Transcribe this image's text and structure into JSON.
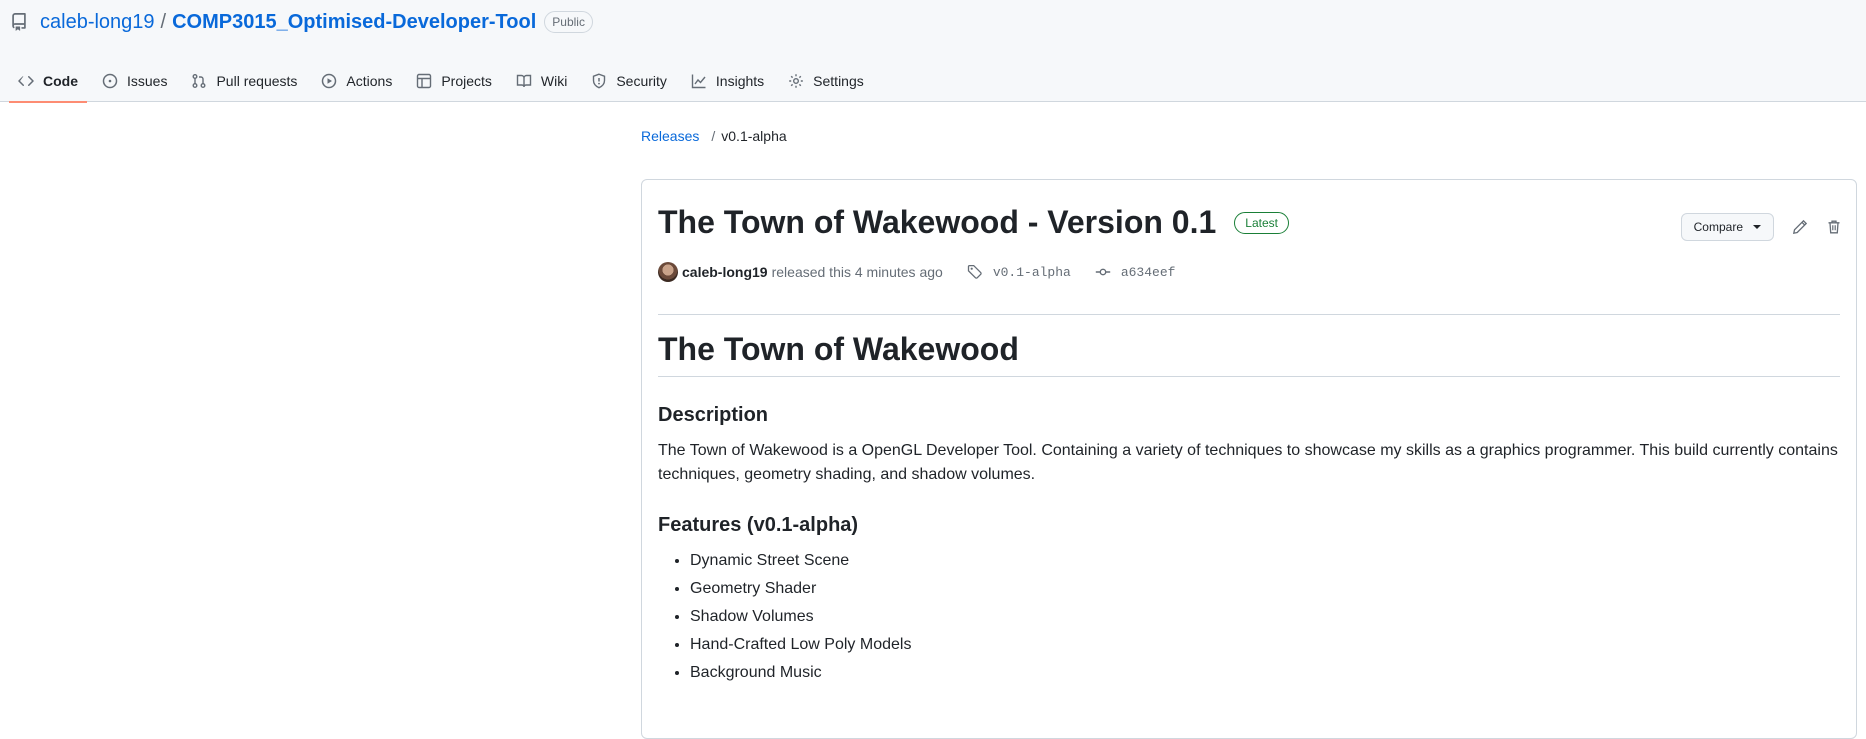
{
  "repo": {
    "owner": "caleb-long19",
    "separator": "/",
    "name": "COMP3015_Optimised-Developer-Tool",
    "visibility": "Public"
  },
  "tabs": [
    {
      "label": "Code",
      "icon": "code-icon",
      "active": true
    },
    {
      "label": "Issues",
      "icon": "issue-icon"
    },
    {
      "label": "Pull requests",
      "icon": "pull-request-icon"
    },
    {
      "label": "Actions",
      "icon": "play-icon"
    },
    {
      "label": "Projects",
      "icon": "table-icon"
    },
    {
      "label": "Wiki",
      "icon": "book-icon"
    },
    {
      "label": "Security",
      "icon": "shield-icon"
    },
    {
      "label": "Insights",
      "icon": "graph-icon"
    },
    {
      "label": "Settings",
      "icon": "gear-icon"
    }
  ],
  "breadcrumb": {
    "releases": "Releases",
    "separator": "/",
    "current": "v0.1-alpha"
  },
  "release": {
    "title": "The Town of Wakewood - Version 0.1",
    "badge": "Latest",
    "compare_label": "Compare",
    "author": "caleb-long19",
    "released_text": "released this 4 minutes ago",
    "tag": "v0.1-alpha",
    "commit": "a634eef"
  },
  "body": {
    "heading": "The Town of Wakewood",
    "description_heading": "Description",
    "description": "The Town of Wakewood is a OpenGL Developer Tool. Containing a variety of techniques to showcase my skills as a graphics programmer. This build currently contains techniques, geometry shading, and shadow volumes.",
    "features_heading": "Features (v0.1-alpha)",
    "features": [
      "Dynamic Street Scene",
      "Geometry Shader",
      "Shadow Volumes",
      "Hand-Crafted Low Poly Models",
      "Background Music"
    ]
  },
  "colors": {
    "link": "#0969da",
    "active_tab_underline": "#fd8c73",
    "latest_badge": "#1a7f37"
  }
}
